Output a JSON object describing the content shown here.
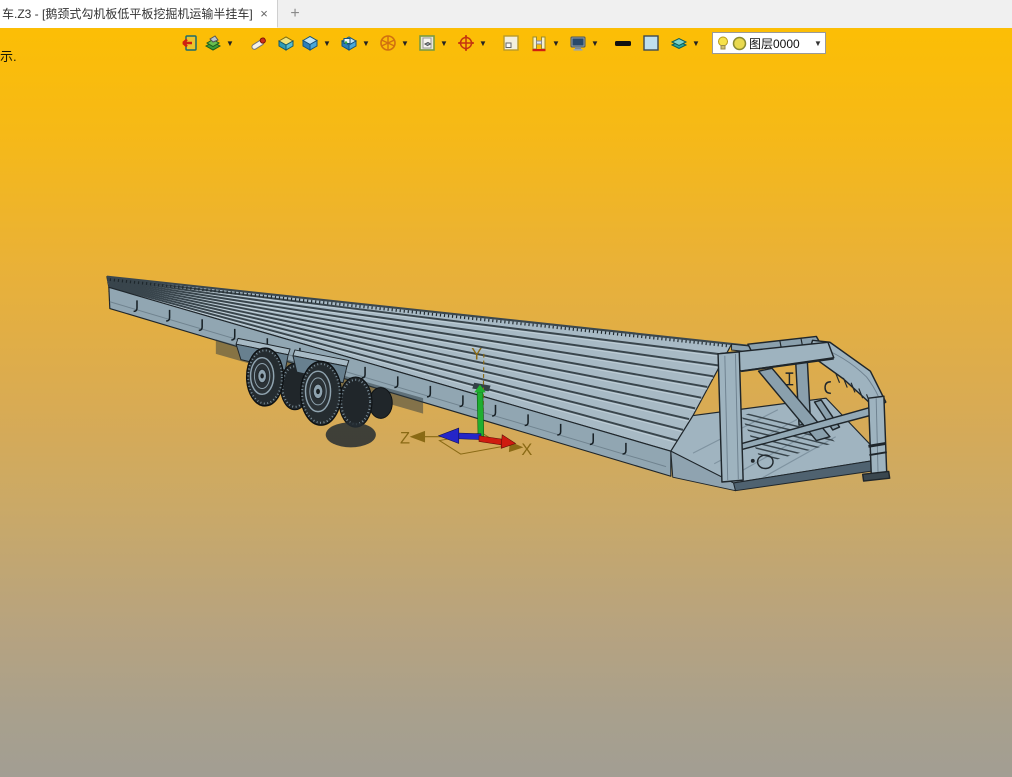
{
  "window": {
    "tab": {
      "title": "车.Z3 - [鹅颈式勾机板低平板挖掘机运输半挂车]",
      "close_glyph": "×"
    },
    "new_tab_glyph": "+"
  },
  "hint": {
    "text": "示."
  },
  "toolbar": {
    "icons": [
      {
        "name": "exit-icon",
        "dropdown": false
      },
      {
        "name": "display-shade-icon",
        "dropdown": true
      },
      {
        "name": "eraser-icon",
        "dropdown": false
      },
      {
        "name": "box-open-icon",
        "dropdown": false
      },
      {
        "name": "shaded-cube-icon",
        "dropdown": true
      },
      {
        "name": "cube-screen-icon",
        "dropdown": true
      },
      {
        "name": "wireframe-sphere-icon",
        "dropdown": true
      },
      {
        "name": "framed-view-icon",
        "dropdown": true
      },
      {
        "name": "compass-icon",
        "dropdown": true
      },
      {
        "name": "corner-box-icon",
        "dropdown": false
      },
      {
        "name": "clamp-icon",
        "dropdown": true
      },
      {
        "name": "monitor-icon",
        "dropdown": true
      },
      {
        "name": "line-width-icon",
        "dropdown": false
      },
      {
        "name": "color-swatch-icon",
        "dropdown": false
      },
      {
        "name": "layers-icon",
        "dropdown": true
      }
    ],
    "layer_combo": {
      "value": "图层0000",
      "bulb_icon": "light-bulb-icon",
      "layer_color_swatch": "#e9d94f"
    }
  },
  "viewport": {
    "triad": {
      "x_label": "X",
      "y_label": "Y",
      "z_label": "Z"
    },
    "colors": {
      "bg_top": "#fcbe05",
      "bg_bottom": "#a29e93",
      "model_body": "#9fb3bf",
      "model_light": "#a8bac5",
      "model_dark": "#68808f",
      "outline": "#1f262b",
      "tire": "#252c30",
      "axis_x_red": "#cf1b10",
      "axis_z_blue": "#2525c8",
      "axis_y_green": "#1fae30",
      "datum_brown": "#8a6a15"
    }
  }
}
